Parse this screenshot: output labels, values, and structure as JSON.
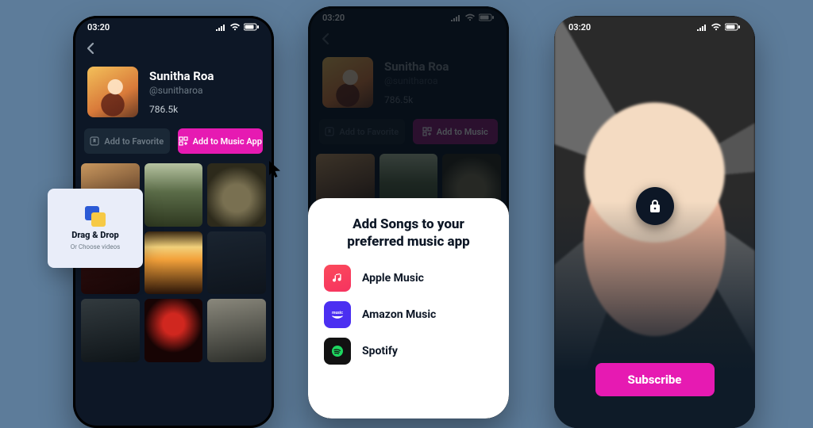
{
  "status_time": "03:20",
  "profile": {
    "name": "Sunitha Roa",
    "handle": "@sunitharoa",
    "count": "786.5k"
  },
  "buttons": {
    "fav": "Add to Favorite",
    "music": "Add to Music App",
    "music_short": "Add to Music"
  },
  "dragdrop": {
    "title": "Drag & Drop",
    "sub": "Or Choose videos"
  },
  "sheet": {
    "heading_line1": "Add Songs to your",
    "heading_line2": "preferred music app",
    "apps": [
      {
        "label": "Apple Music"
      },
      {
        "label": "Amazon Music"
      },
      {
        "label": "Spotify"
      }
    ]
  },
  "subscribe": "Subscribe"
}
